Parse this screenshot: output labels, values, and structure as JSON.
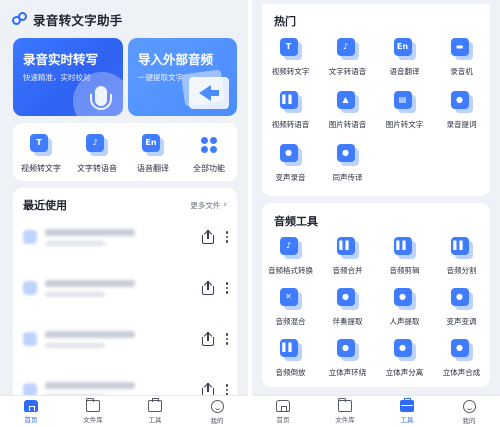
{
  "colors": {
    "accent": "#2f6bf6",
    "tile": "#3f7cff",
    "tile_shadow": "#bcd2ff",
    "bg": "#eef1f6"
  },
  "app": {
    "title": "录音转文字助手",
    "logo_icon": "link-logo-icon"
  },
  "hero": {
    "record": {
      "title": "录音实时转写",
      "subtitle": "快速精准，实时校对",
      "icon": "microphone-icon"
    },
    "import": {
      "title": "导入外部音频",
      "subtitle": "一键提取文字",
      "icon": "import-arrow-icon"
    }
  },
  "quick_actions": [
    {
      "label": "视频转文字",
      "glyph": "T",
      "icon": "video-to-text-icon"
    },
    {
      "label": "文字转语音",
      "glyph": "♪",
      "icon": "text-to-speech-icon"
    },
    {
      "label": "语音翻译",
      "glyph": "En",
      "icon": "voice-translate-icon"
    },
    {
      "label": "全部功能",
      "glyph": "",
      "icon": "all-features-icon"
    }
  ],
  "recent": {
    "title": "最近使用",
    "more_label": "更多文件",
    "items": [
      {
        "name": "",
        "meta": ""
      },
      {
        "name": "",
        "meta": ""
      },
      {
        "name": "",
        "meta": ""
      },
      {
        "name": "",
        "meta": ""
      }
    ]
  },
  "tabs": [
    {
      "label": "首页",
      "icon": "home-icon"
    },
    {
      "label": "文件库",
      "icon": "folder-icon"
    },
    {
      "label": "工具",
      "icon": "toolbox-icon"
    },
    {
      "label": "我的",
      "icon": "profile-icon"
    }
  ],
  "left_active_tab": 0,
  "right_active_tab": 2,
  "hot_section": {
    "title": "热门",
    "items": [
      {
        "label": "视频转文字",
        "glyph": "T",
        "icon": "video-to-text-icon"
      },
      {
        "label": "文字转语音",
        "glyph": "♪",
        "icon": "text-to-speech-icon"
      },
      {
        "label": "语音翻译",
        "glyph": "En",
        "icon": "voice-translate-icon"
      },
      {
        "label": "录音机",
        "glyph": "▬",
        "icon": "recorder-icon"
      },
      {
        "label": "视频转语音",
        "glyph": "▌▌",
        "icon": "video-to-audio-icon"
      },
      {
        "label": "图片转语音",
        "glyph": "▲",
        "icon": "image-to-audio-icon"
      },
      {
        "label": "图片转文字",
        "glyph": "▤",
        "icon": "image-to-text-icon"
      },
      {
        "label": "录音提词",
        "glyph": "●",
        "icon": "teleprompter-icon"
      },
      {
        "label": "变声录音",
        "glyph": "●",
        "icon": "voice-changer-record-icon"
      },
      {
        "label": "同声传译",
        "glyph": "●",
        "icon": "simultaneous-interpret-icon"
      }
    ]
  },
  "audio_section": {
    "title": "音频工具",
    "items": [
      {
        "label": "音频格式转换",
        "glyph": "♪",
        "icon": "audio-format-convert-icon"
      },
      {
        "label": "音频合并",
        "glyph": "▌▌",
        "icon": "audio-merge-icon"
      },
      {
        "label": "音频剪辑",
        "glyph": "▌▌",
        "icon": "audio-clip-icon"
      },
      {
        "label": "音频分割",
        "glyph": "▌▌",
        "icon": "audio-split-icon"
      },
      {
        "label": "音频混合",
        "glyph": "✕",
        "icon": "audio-mix-icon"
      },
      {
        "label": "伴奏提取",
        "glyph": "●",
        "icon": "accompaniment-extract-icon"
      },
      {
        "label": "人声提取",
        "glyph": "●",
        "icon": "vocal-extract-icon"
      },
      {
        "label": "变声变调",
        "glyph": "●",
        "icon": "pitch-shift-icon"
      },
      {
        "label": "音频倒放",
        "glyph": "▌▌",
        "icon": "audio-reverse-icon"
      },
      {
        "label": "立体声环绕",
        "glyph": "●",
        "icon": "stereo-surround-icon"
      },
      {
        "label": "立体声分离",
        "glyph": "●",
        "icon": "stereo-separate-icon"
      },
      {
        "label": "立体声合成",
        "glyph": "●",
        "icon": "stereo-synthesis-icon"
      }
    ]
  }
}
